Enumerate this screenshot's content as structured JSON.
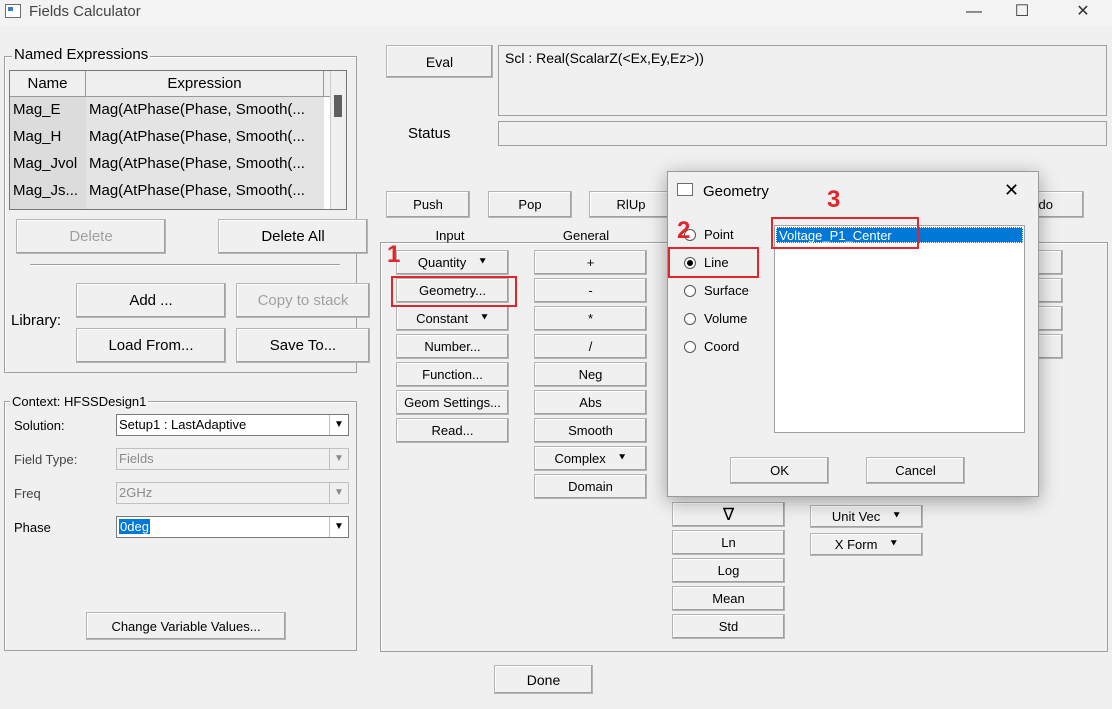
{
  "window": {
    "title": "Fields Calculator",
    "min": "—",
    "max": "☐",
    "close": "✕"
  },
  "named": {
    "legend": "Named Expressions",
    "col_name": "Name",
    "col_expr": "Expression",
    "rows": [
      {
        "name": "Mag_E",
        "expr": "Mag(AtPhase(Phase, Smooth(..."
      },
      {
        "name": "Mag_H",
        "expr": "Mag(AtPhase(Phase, Smooth(..."
      },
      {
        "name": "Mag_Jvol",
        "expr": "Mag(AtPhase(Phase, Smooth(..."
      },
      {
        "name": "Mag_Js...",
        "expr": "Mag(AtPhase(Phase, Smooth(..."
      }
    ],
    "delete": "Delete",
    "delete_all": "Delete All",
    "library": "Library:",
    "add": "Add ...",
    "copy_to_stack": "Copy to stack",
    "load_from": "Load From...",
    "save_to": "Save To..."
  },
  "context": {
    "legend": "Context: HFSSDesign1",
    "solution_label": "Solution:",
    "solution": "Setup1 : LastAdaptive",
    "fieldtype_label": "Field Type:",
    "fieldtype": "Fields",
    "freq_label": "Freq",
    "freq": "2GHz",
    "phase_label": "Phase",
    "phase": "0deg",
    "change_vars": "Change Variable Values..."
  },
  "eval": {
    "button": "Eval",
    "expression": "Scl : Real(ScalarZ(<Ex,Ey,Ez>))",
    "status_label": "Status",
    "status": ""
  },
  "stack": {
    "push": "Push",
    "pop": "Pop",
    "rlup": "RlUp",
    "undo": "do"
  },
  "input": {
    "header": "Input",
    "buttons": [
      "Quantity",
      "Geometry...",
      "Constant",
      "Number...",
      "Function...",
      "Geom Settings...",
      "Read..."
    ]
  },
  "general": {
    "header": "General",
    "buttons": [
      "+",
      "-",
      "*",
      "/",
      "Neg",
      "Abs",
      "Smooth",
      "Complex",
      "Domain"
    ]
  },
  "scalar": {
    "buttons": [
      "∇",
      "Ln",
      "Log",
      "Mean",
      "Std"
    ]
  },
  "vector": {
    "buttons": [
      "Unit Vec",
      "X Form"
    ]
  },
  "done": "Done",
  "dialog": {
    "title": "Geometry",
    "close": "✕",
    "options": [
      "Point",
      "Line",
      "Surface",
      "Volume",
      "Coord"
    ],
    "selected": "Line",
    "items": [
      "Voltage_P1_Center"
    ],
    "ok": "OK",
    "cancel": "Cancel"
  },
  "annotations": {
    "n1": "1",
    "n2": "2",
    "n3": "3",
    "color": "#e0252b"
  }
}
